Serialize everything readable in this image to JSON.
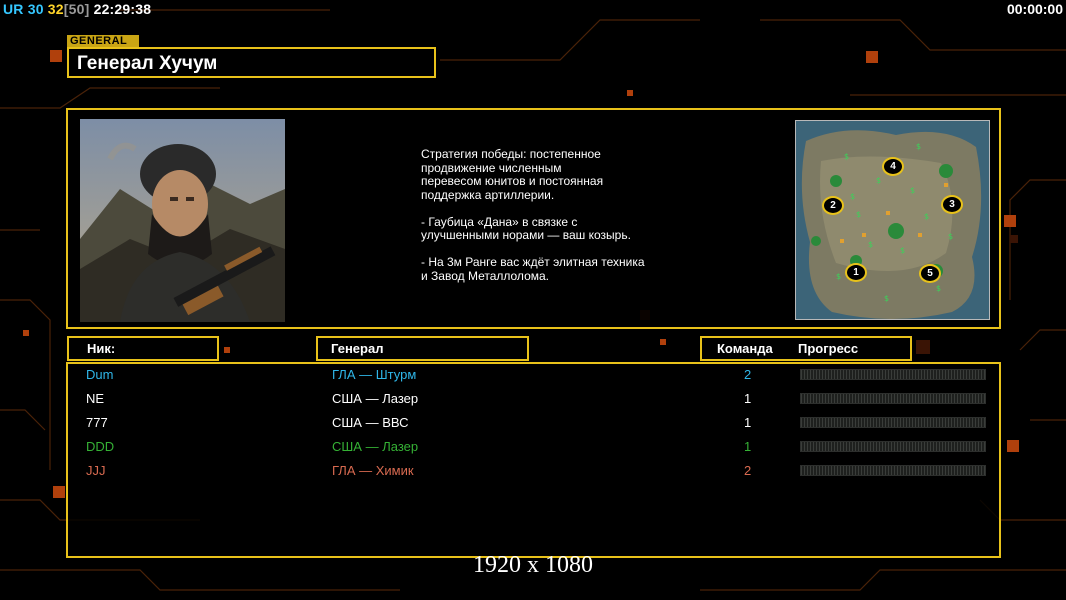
{
  "hud": {
    "ur": "UR",
    "num1": "30",
    "num2": "32",
    "bracket": "[50]",
    "clock": "22:29:38",
    "timer": "00:00:00"
  },
  "general": {
    "tag": "GENERAL",
    "name": "Генерал Хучум"
  },
  "description": "Стратегия победы: постепенное\nпродвижение численным\nперевесом юнитов и постоянная\nподдержка артиллерии.\n\n- Гаубица «Дана» в связке с\nулучшенными норами — ваш козырь.\n\n- На 3м Ранге вас ждёт элитная техника\nи Завод Металлолома.",
  "minimap": {
    "positions": [
      "4",
      "2",
      "3",
      "1",
      "5"
    ]
  },
  "table": {
    "headers": {
      "nick": "Ник:",
      "general": "Генерал",
      "team": "Команда",
      "progress": "Прогресс"
    },
    "rows": [
      {
        "nick": "Dum",
        "general": "ГЛА — Штурм",
        "team": "2",
        "color": "#2fb6e8",
        "progress": 0
      },
      {
        "nick": "NE",
        "general": "США — Лазер",
        "team": "1",
        "color": "#ffffff",
        "progress": 0
      },
      {
        "nick": "777",
        "general": "США — ВВС",
        "team": "1",
        "color": "#ffffff",
        "progress": 0
      },
      {
        "nick": "DDD",
        "general": "США — Лазер",
        "team": "1",
        "color": "#35b135",
        "progress": 0
      },
      {
        "nick": "JJJ",
        "general": "ГЛА — Химик",
        "team": "2",
        "color": "#d86a50",
        "progress": 0
      }
    ]
  },
  "resolution": "1920 x 1080"
}
